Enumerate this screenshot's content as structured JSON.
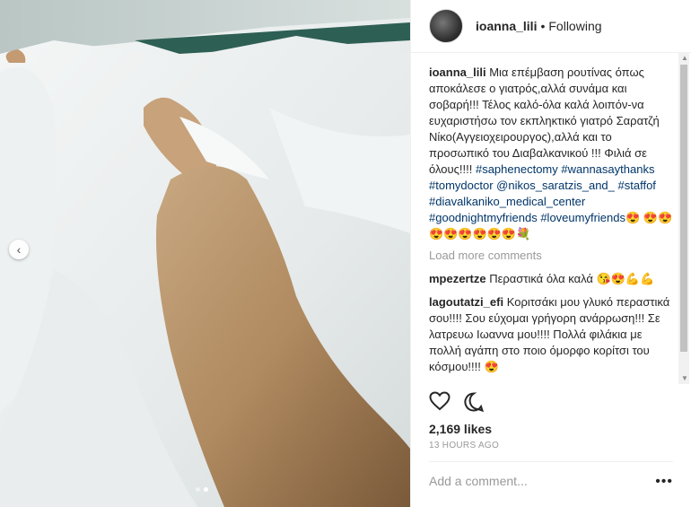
{
  "header": {
    "username": "ioanna_lili",
    "separator": "•",
    "follow_status": "Following"
  },
  "caption": {
    "username": "ioanna_lili",
    "text": "Μια επέμβαση ρουτίνας όπως αποκάλεσε ο γιατρός,αλλά συνάμα και σοβαρή!!! Τέλος καλό-όλα καλά λοιπόν-να ευχαριστήσω τον εκπληκτικό γιατρό Σαρατζή Νίκο(Αγγειοχειρουργος),αλλά και το προσωπικό του Διαβαλκανικού !!! Φιλιά σε όλους!!!!",
    "tags": [
      "#saphenectomy",
      "#wannasaythanks",
      "#tomydoctor",
      "@nikos_saratzis_and_",
      "#staffof",
      "#diavalkaniko_medical_center",
      "#goodnightmyfriends",
      "#loveumyfriends😍"
    ],
    "emojis": "😍😍😍😍😍😍😍😍💐"
  },
  "load_more": "Load more comments",
  "comments": [
    {
      "username": "mpezertze",
      "text": "Περαστικά όλα καλά 😘😍💪💪"
    },
    {
      "username": "lagoutatzi_efi",
      "text": "Κοριτσάκι μου γλυκό περαστικά σου!!!! Σου εύχομαι γρήγορη ανάρρωση!!! Σε λατρευω Ιωαννα μου!!!! Πολλά φιλάκια με πολλή αγάπη στο ποιο όμορφο κορίτσι του κόσμου!!!! 😍"
    }
  ],
  "likes": "2,169 likes",
  "timestamp": "13 HOURS AGO",
  "add_comment_placeholder": "Add a comment...",
  "more_options": "•••",
  "icons": {
    "like": "heart-icon",
    "comment": "comment-bubble-icon",
    "carousel_prev": "chevron-left-icon"
  },
  "carousel": {
    "slides": 2,
    "active": 1
  },
  "colors": {
    "hashtag": "#003569",
    "muted": "#999999",
    "text": "#262626"
  }
}
